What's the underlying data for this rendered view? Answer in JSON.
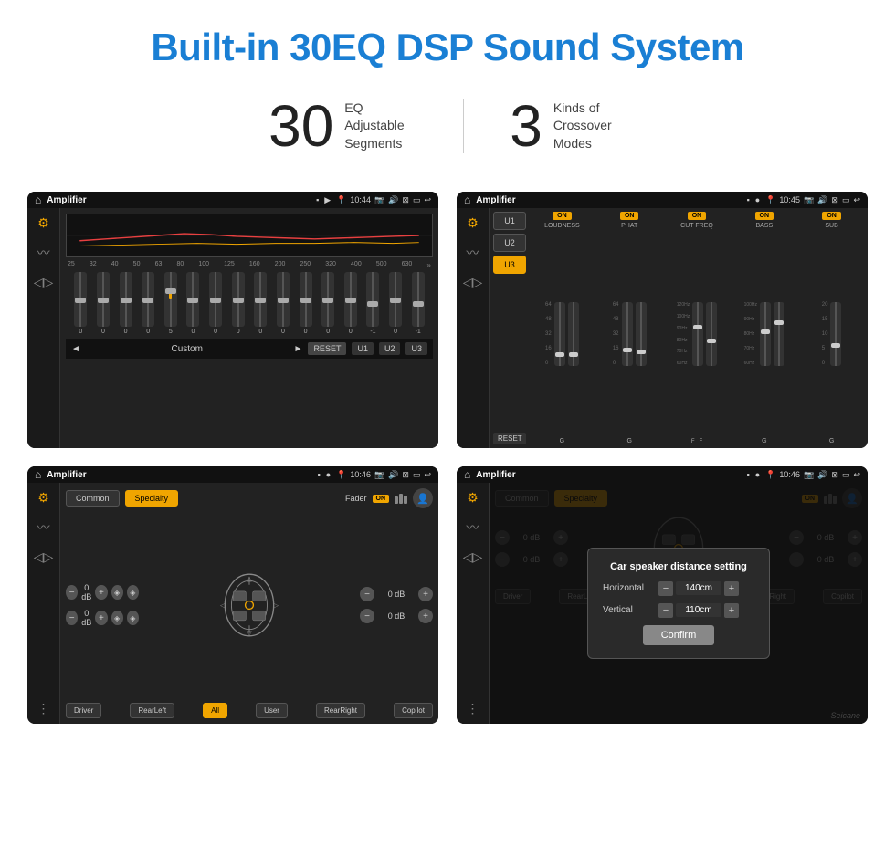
{
  "header": {
    "title": "Built-in 30EQ DSP Sound System",
    "accent_color": "#1a7fd4"
  },
  "stats": [
    {
      "number": "30",
      "desc": "EQ Adjustable\nSegments"
    },
    {
      "number": "3",
      "desc": "Kinds of\nCrossover Modes"
    }
  ],
  "screens": [
    {
      "id": "eq-screen",
      "title": "Amplifier",
      "time": "10:44",
      "type": "eq",
      "freqs": [
        "25",
        "32",
        "40",
        "50",
        "63",
        "80",
        "100",
        "125",
        "160",
        "200",
        "250",
        "320",
        "400",
        "500",
        "630"
      ],
      "values": [
        "0",
        "0",
        "0",
        "0",
        "5",
        "0",
        "0",
        "0",
        "0",
        "0",
        "0",
        "0",
        "0",
        "-1",
        "0",
        "-1"
      ],
      "presets": [
        "RESET",
        "U1",
        "U2",
        "U3"
      ],
      "current_preset": "Custom"
    },
    {
      "id": "crossover-screen",
      "title": "Amplifier",
      "time": "10:45",
      "type": "crossover",
      "presets": [
        "U1",
        "U2",
        "U3"
      ],
      "active_preset": "U3",
      "channels": [
        {
          "label": "LOUDNESS",
          "on": true,
          "vals": [
            "64",
            "48",
            "32",
            "16",
            "0"
          ]
        },
        {
          "label": "PHAT",
          "on": true,
          "vals": [
            "64",
            "48",
            "32",
            "16",
            "0"
          ]
        },
        {
          "label": "CUT FREQ",
          "on": true,
          "vals": [
            "120Hz",
            "100Hz",
            "90Hz",
            "80Hz",
            "70Hz",
            "60Hz"
          ]
        },
        {
          "label": "BASS",
          "on": true,
          "vals": [
            "100Hz",
            "90Hz",
            "80Hz",
            "70Hz",
            "60Hz"
          ]
        },
        {
          "label": "SUB",
          "on": true,
          "vals": [
            "20",
            "15",
            "10",
            "5",
            "0"
          ]
        }
      ],
      "reset_label": "RESET"
    },
    {
      "id": "amp-screen",
      "title": "Amplifier",
      "time": "10:46",
      "type": "amplifier",
      "modes": [
        "Common",
        "Specialty"
      ],
      "active_mode": "Specialty",
      "fader_label": "Fader",
      "fader_on": "ON",
      "db_values": [
        "0 dB",
        "0 dB",
        "0 dB",
        "0 dB"
      ],
      "seats": [
        "Driver",
        "RearLeft",
        "All",
        "User",
        "RearRight",
        "Copilot"
      ],
      "active_seat": "All"
    },
    {
      "id": "amp-dialog-screen",
      "title": "Amplifier",
      "time": "10:46",
      "type": "amplifier-dialog",
      "modes": [
        "Common",
        "Specialty"
      ],
      "active_mode": "Specialty",
      "dialog": {
        "title": "Car speaker distance setting",
        "horizontal_label": "Horizontal",
        "horizontal_value": "140cm",
        "vertical_label": "Vertical",
        "vertical_value": "110cm",
        "confirm_label": "Confirm"
      },
      "db_values": [
        "0 dB",
        "0 dB"
      ],
      "seats": [
        "Driver",
        "RearLeft",
        "All",
        "User",
        "RearRight",
        "Copilot"
      ]
    }
  ],
  "watermark": "Seicane"
}
